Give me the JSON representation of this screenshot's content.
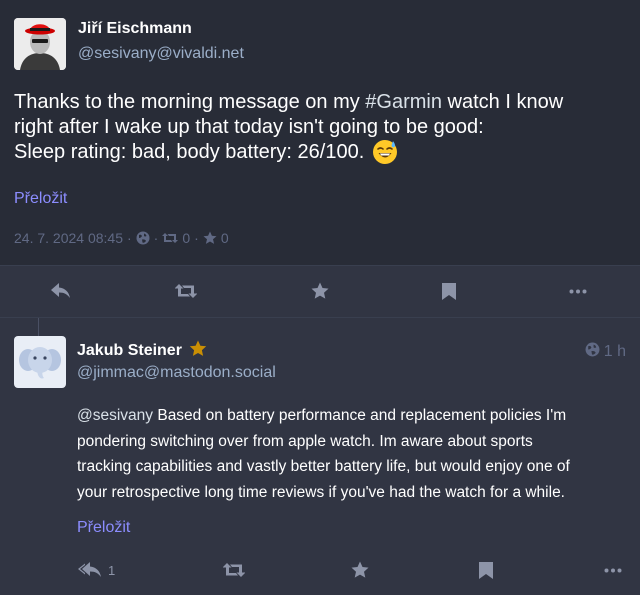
{
  "main_post": {
    "display_name": "Jiří Eischmann",
    "handle": "@sesivany@vivaldi.net",
    "content_lines": [
      [
        "Thanks to the morning message on my ",
        "#Garmin",
        " watch I know"
      ],
      [
        "right after I wake up that today isn't going to be good:"
      ],
      [
        "Sleep rating: bad, body battery: 26/100. "
      ]
    ],
    "emoji": "sweat-smile-emoji",
    "translate_label": "Přeložit",
    "timestamp": "24. 7. 2024 08:45",
    "separator": "·",
    "boost_count": "0",
    "favourite_count": "0"
  },
  "main_actions": {
    "icons": [
      "reply-icon",
      "boost-icon",
      "favourite-icon",
      "bookmark-icon",
      "more-icon"
    ]
  },
  "reply": {
    "display_name": "Jakub Steiner",
    "badge": "star-badge-icon",
    "handle": "@jimmac@mastodon.social",
    "relative_time": "1 h",
    "content_lines": [
      "@sesivany Based on battery performance and replacement policies I'm",
      "pondering switching over from apple watch. Im aware about sports",
      "tracking capabilities and vastly better battery life, but would enjoy one of",
      "your retrospective long time reviews if you've had the watch for a while."
    ],
    "translate_label": "Přeložit",
    "reply_count": "1"
  },
  "colors": {
    "background": "#282c37",
    "action_bar": "#313543",
    "link": "#8c8dff",
    "muted": "#606984",
    "handle": "#9baec8",
    "star": "#ca8f04"
  }
}
